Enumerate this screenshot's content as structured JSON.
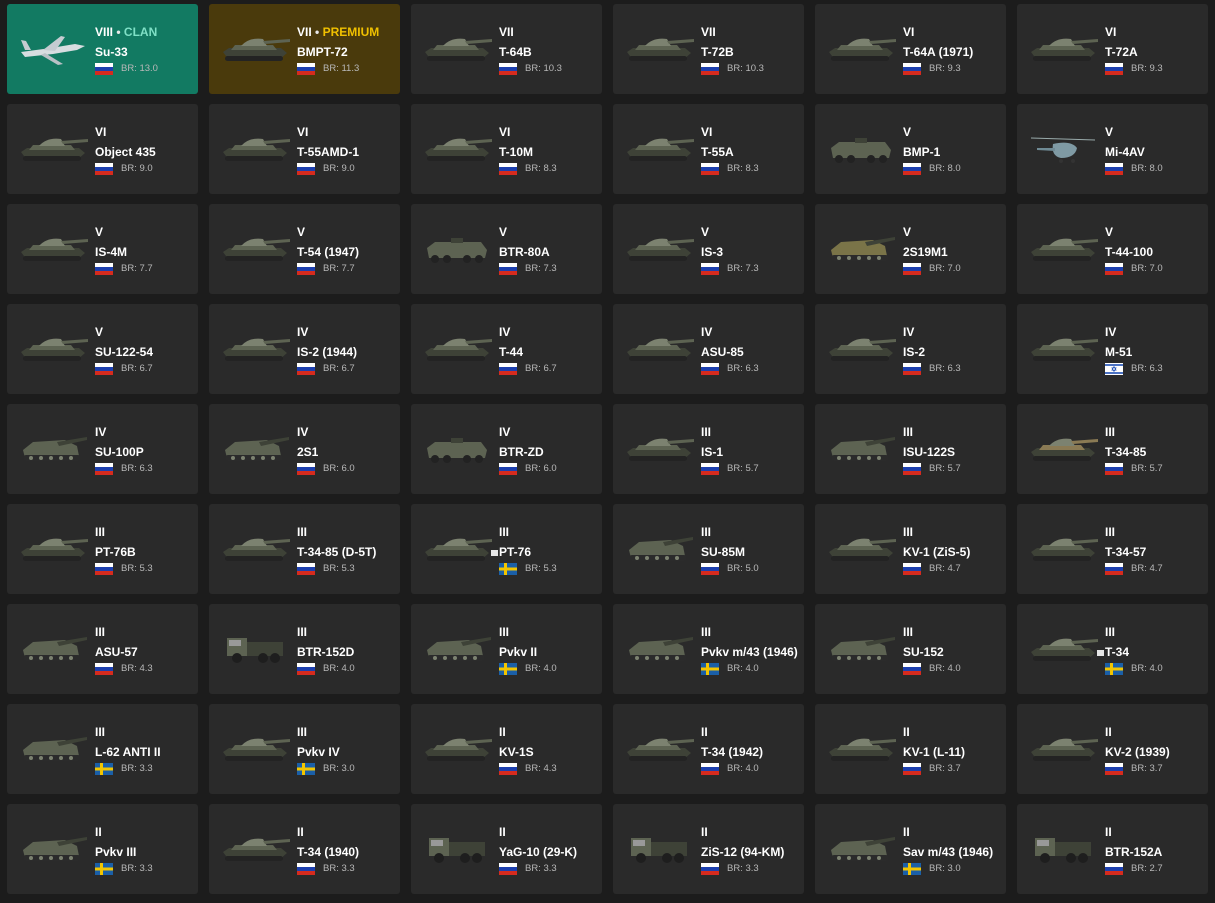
{
  "colors": {
    "background": "#1c1c1c",
    "card": "#2a2a2a",
    "clan_card": "#127a62",
    "premium_card": "#4a3a0c",
    "clan_text": "#7fe0c6",
    "premium_text": "#f0c000"
  },
  "flags": {
    "ussr": "flag-ussr-icon",
    "sweden": "flag-sweden-icon",
    "israel": "flag-israel-icon"
  },
  "vehicles": [
    {
      "rank": "VIII",
      "tag": "CLAN",
      "name": "Su-33",
      "br": "BR: 13.0",
      "flag": "ussr",
      "kind": "plane",
      "special": "clan"
    },
    {
      "rank": "VII",
      "tag": "PREMIUM",
      "name": "BMPT-72",
      "br": "BR: 11.3",
      "flag": "ussr",
      "kind": "tank",
      "special": "premium"
    },
    {
      "rank": "VII",
      "name": "T-64B",
      "br": "BR: 10.3",
      "flag": "ussr",
      "kind": "tank"
    },
    {
      "rank": "VII",
      "name": "T-72B",
      "br": "BR: 10.3",
      "flag": "ussr",
      "kind": "tank"
    },
    {
      "rank": "VI",
      "name": "T-64A (1971)",
      "br": "BR: 9.3",
      "flag": "ussr",
      "kind": "tank"
    },
    {
      "rank": "VI",
      "name": "T-72A",
      "br": "BR: 9.3",
      "flag": "ussr",
      "kind": "tank"
    },
    {
      "rank": "VI",
      "name": "Object 435",
      "br": "BR: 9.0",
      "flag": "ussr",
      "kind": "tank"
    },
    {
      "rank": "VI",
      "name": "T-55AMD-1",
      "br": "BR: 9.0",
      "flag": "ussr",
      "kind": "tank"
    },
    {
      "rank": "VI",
      "name": "T-10M",
      "br": "BR: 8.3",
      "flag": "ussr",
      "kind": "tank"
    },
    {
      "rank": "VI",
      "name": "T-55A",
      "br": "BR: 8.3",
      "flag": "ussr",
      "kind": "tank"
    },
    {
      "rank": "V",
      "name": "BMP-1",
      "br": "BR: 8.0",
      "flag": "ussr",
      "kind": "apc"
    },
    {
      "rank": "V",
      "name": "Mi-4AV",
      "br": "BR: 8.0",
      "flag": "ussr",
      "kind": "heli"
    },
    {
      "rank": "V",
      "name": "IS-4M",
      "br": "BR: 7.7",
      "flag": "ussr",
      "kind": "tank"
    },
    {
      "rank": "V",
      "name": "T-54 (1947)",
      "br": "BR: 7.7",
      "flag": "ussr",
      "kind": "tank"
    },
    {
      "rank": "V",
      "name": "BTR-80A",
      "br": "BR: 7.3",
      "flag": "ussr",
      "kind": "apc"
    },
    {
      "rank": "V",
      "name": "IS-3",
      "br": "BR: 7.3",
      "flag": "ussr",
      "kind": "tank"
    },
    {
      "rank": "V",
      "name": "2S19M1",
      "br": "BR: 7.0",
      "flag": "ussr",
      "kind": "spg",
      "tint": "#7a7448"
    },
    {
      "rank": "V",
      "name": "T-44-100",
      "br": "BR: 7.0",
      "flag": "ussr",
      "kind": "tank"
    },
    {
      "rank": "V",
      "name": "SU-122-54",
      "br": "BR: 6.7",
      "flag": "ussr",
      "kind": "tank"
    },
    {
      "rank": "IV",
      "name": "IS-2 (1944)",
      "br": "BR: 6.7",
      "flag": "ussr",
      "kind": "tank"
    },
    {
      "rank": "IV",
      "name": "T-44",
      "br": "BR: 6.7",
      "flag": "ussr",
      "kind": "tank"
    },
    {
      "rank": "IV",
      "name": "ASU-85",
      "br": "BR: 6.3",
      "flag": "ussr",
      "kind": "tank"
    },
    {
      "rank": "IV",
      "name": "IS-2",
      "br": "BR: 6.3",
      "flag": "ussr",
      "kind": "tank"
    },
    {
      "rank": "IV",
      "name": "M-51",
      "br": "BR: 6.3",
      "flag": "israel",
      "kind": "tank"
    },
    {
      "rank": "IV",
      "name": "SU-100P",
      "br": "BR: 6.3",
      "flag": "ussr",
      "kind": "spg"
    },
    {
      "rank": "IV",
      "name": "2S1",
      "br": "BR: 6.0",
      "flag": "ussr",
      "kind": "spg"
    },
    {
      "rank": "IV",
      "name": "BTR-ZD",
      "br": "BR: 6.0",
      "flag": "ussr",
      "kind": "apc"
    },
    {
      "rank": "III",
      "name": "IS-1",
      "br": "BR: 5.7",
      "flag": "ussr",
      "kind": "tank"
    },
    {
      "rank": "III",
      "name": "ISU-122S",
      "br": "BR: 5.7",
      "flag": "ussr",
      "kind": "spg"
    },
    {
      "rank": "III",
      "name": "T-34-85",
      "br": "BR: 5.7",
      "flag": "ussr",
      "kind": "tank",
      "tint": "#8a7a54"
    },
    {
      "rank": "III",
      "name": "PT-76B",
      "br": "BR: 5.3",
      "flag": "ussr",
      "kind": "tank"
    },
    {
      "rank": "III",
      "name": "T-34-85 (D-5T)",
      "br": "BR: 5.3",
      "flag": "ussr",
      "kind": "tank"
    },
    {
      "rank": "III",
      "name": "PT-76",
      "br": "BR: 5.3",
      "flag": "sweden",
      "kind": "tank",
      "marker": true
    },
    {
      "rank": "III",
      "name": "SU-85M",
      "br": "BR: 5.0",
      "flag": "ussr",
      "kind": "spg"
    },
    {
      "rank": "III",
      "name": "KV-1 (ZiS-5)",
      "br": "BR: 4.7",
      "flag": "ussr",
      "kind": "tank"
    },
    {
      "rank": "III",
      "name": "T-34-57",
      "br": "BR: 4.7",
      "flag": "ussr",
      "kind": "tank"
    },
    {
      "rank": "III",
      "name": "ASU-57",
      "br": "BR: 4.3",
      "flag": "ussr",
      "kind": "spg"
    },
    {
      "rank": "III",
      "name": "BTR-152D",
      "br": "BR: 4.0",
      "flag": "ussr",
      "kind": "truck"
    },
    {
      "rank": "III",
      "name": "Pvkv II",
      "br": "BR: 4.0",
      "flag": "sweden",
      "kind": "spg"
    },
    {
      "rank": "III",
      "name": "Pvkv m/43 (1946)",
      "br": "BR: 4.0",
      "flag": "sweden",
      "kind": "spg"
    },
    {
      "rank": "III",
      "name": "SU-152",
      "br": "BR: 4.0",
      "flag": "ussr",
      "kind": "spg"
    },
    {
      "rank": "III",
      "name": "T-34",
      "br": "BR: 4.0",
      "flag": "sweden",
      "kind": "tank",
      "marker": true
    },
    {
      "rank": "III",
      "name": "L-62 ANTI II",
      "br": "BR: 3.3",
      "flag": "sweden",
      "kind": "spg"
    },
    {
      "rank": "III",
      "name": "Pvkv IV",
      "br": "BR: 3.0",
      "flag": "sweden",
      "kind": "tank"
    },
    {
      "rank": "II",
      "name": "KV-1S",
      "br": "BR: 4.3",
      "flag": "ussr",
      "kind": "tank"
    },
    {
      "rank": "II",
      "name": "T-34 (1942)",
      "br": "BR: 4.0",
      "flag": "ussr",
      "kind": "tank"
    },
    {
      "rank": "II",
      "name": "KV-1 (L-11)",
      "br": "BR: 3.7",
      "flag": "ussr",
      "kind": "tank"
    },
    {
      "rank": "II",
      "name": "KV-2 (1939)",
      "br": "BR: 3.7",
      "flag": "ussr",
      "kind": "tank"
    },
    {
      "rank": "II",
      "name": "Pvkv III",
      "br": "BR: 3.3",
      "flag": "sweden",
      "kind": "spg"
    },
    {
      "rank": "II",
      "name": "T-34 (1940)",
      "br": "BR: 3.3",
      "flag": "ussr",
      "kind": "tank"
    },
    {
      "rank": "II",
      "name": "YaG-10 (29-K)",
      "br": "BR: 3.3",
      "flag": "ussr",
      "kind": "truck"
    },
    {
      "rank": "II",
      "name": "ZiS-12 (94-KM)",
      "br": "BR: 3.3",
      "flag": "ussr",
      "kind": "truck"
    },
    {
      "rank": "II",
      "name": "Sav m/43 (1946)",
      "br": "BR: 3.0",
      "flag": "sweden",
      "kind": "spg"
    },
    {
      "rank": "II",
      "name": "BTR-152A",
      "br": "BR: 2.7",
      "flag": "ussr",
      "kind": "truck"
    }
  ]
}
